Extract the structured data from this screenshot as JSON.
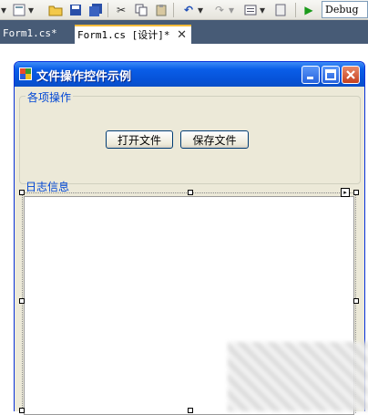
{
  "toolbar": {
    "config_value": "Debug"
  },
  "tabs": [
    {
      "label": "Form1.cs*"
    },
    {
      "label": "Form1.cs [设计]*",
      "close": "✕"
    }
  ],
  "form": {
    "title": "文件操作控件示例",
    "group_ops_label": "各项操作",
    "open_button": "打开文件",
    "save_button": "保存文件",
    "log_label": "日志信息"
  },
  "colors": {
    "title_bar": "#0653d9",
    "tab_strip": "#475b76",
    "group_label": "#0046d5"
  }
}
